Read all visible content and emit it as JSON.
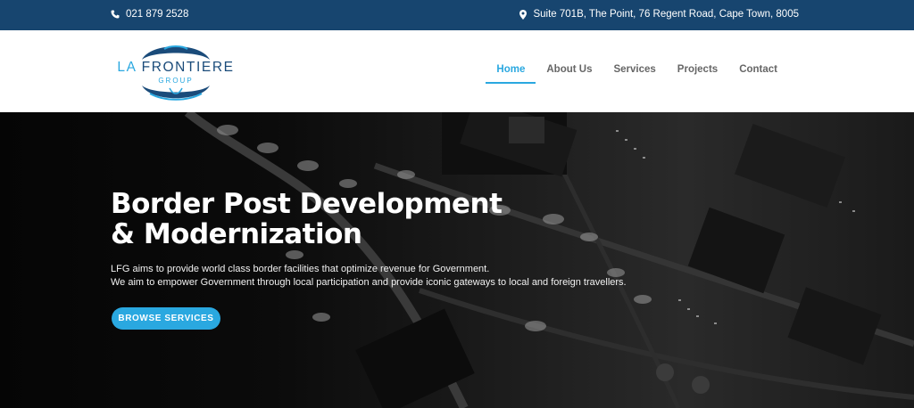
{
  "topbar": {
    "phone": "021 879 2528",
    "address": "Suite 701B, The Point, 76 Regent Road, Cape Town, 8005"
  },
  "logo": {
    "line1_first": "LA",
    "line1_rest": "FRONTIERE",
    "line2": "GROUP"
  },
  "nav": {
    "items": [
      {
        "label": "Home",
        "active": true
      },
      {
        "label": "About Us",
        "active": false
      },
      {
        "label": "Services",
        "active": false
      },
      {
        "label": "Projects",
        "active": false
      },
      {
        "label": "Contact",
        "active": false
      }
    ]
  },
  "hero": {
    "title_line1": "Border Post Development",
    "title_line2": "& Modernization",
    "text_line1": "LFG aims to provide world class border facilities that optimize revenue for Government.",
    "text_line2": "We aim to empower Government through local participation and provide iconic gateways to local and foreign travellers.",
    "button": "BROWSE SERVICES"
  },
  "colors": {
    "topbar": "#17456f",
    "accent": "#2aa8e0",
    "nav_text": "#666666"
  },
  "icons": [
    "phone-icon",
    "map-pin-icon"
  ]
}
